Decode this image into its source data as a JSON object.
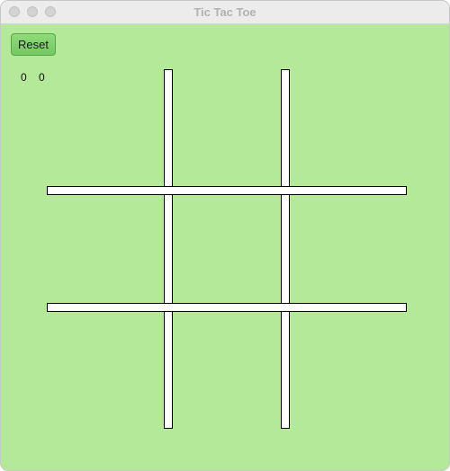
{
  "window": {
    "title": "Tic Tac Toe"
  },
  "toolbar": {
    "reset_label": "Reset"
  },
  "score": {
    "x": "0",
    "o": "0"
  },
  "board": {
    "cells": [
      "",
      "",
      "",
      "",
      "",
      "",
      "",
      "",
      ""
    ]
  },
  "colors": {
    "background": "#b4e99a",
    "button": "#80d06c",
    "grid_line": "#ffffff",
    "grid_border": "#000000"
  }
}
